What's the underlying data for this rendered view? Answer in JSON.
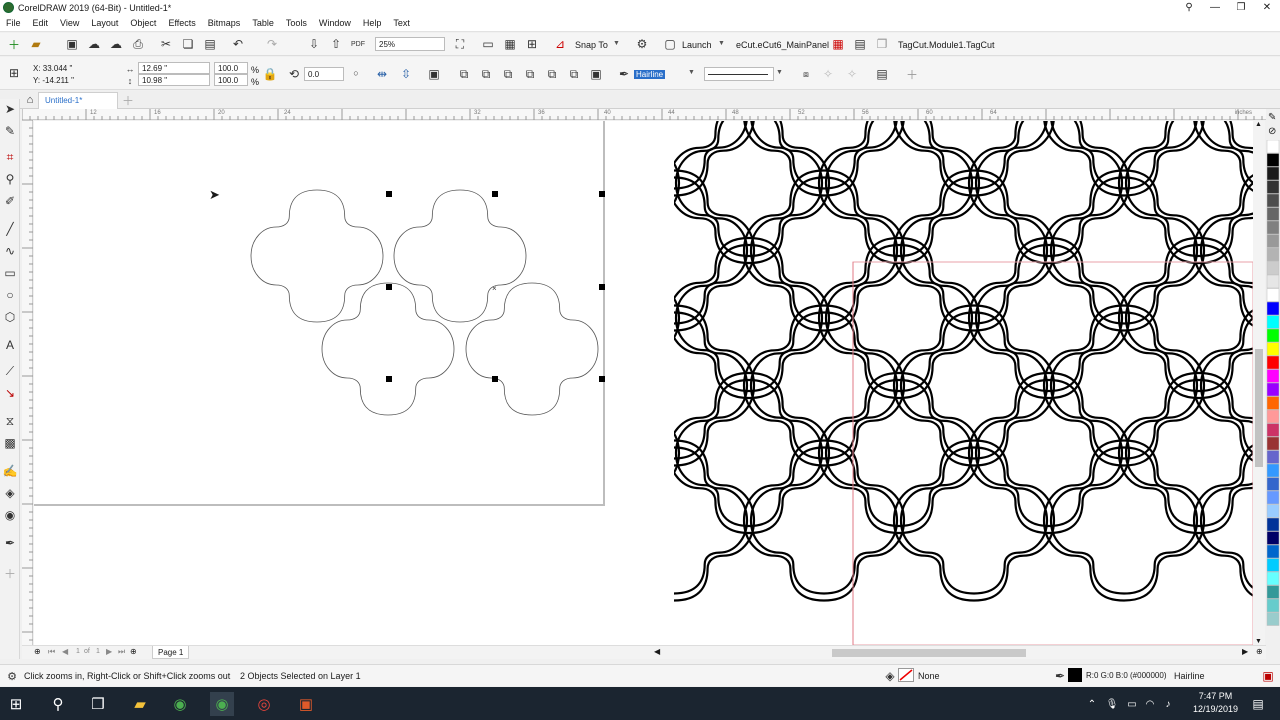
{
  "app": {
    "title": "CorelDRAW 2019 (64-Bit) - Untitled-1*"
  },
  "menu": [
    "File",
    "Edit",
    "View",
    "Layout",
    "Object",
    "Effects",
    "Bitmaps",
    "Table",
    "Tools",
    "Window",
    "Help",
    "Text"
  ],
  "toolbar1": {
    "zoom_value": "25%",
    "snap_label": "Snap To",
    "launch_label": "Launch",
    "macro_label": "eCut.eCut6_MainPanel",
    "tagcut_label": "TagCut.Module1.TagCut"
  },
  "toolbar2": {
    "x": "X: 33.044 \"",
    "y": "Y: -14.211 \"",
    "w": "12.69 \"",
    "h": "10.98 \"",
    "scale_w": "100.0",
    "scale_h": "100.0",
    "pct": "%",
    "rotation": "0.0",
    "outline": "Hairline"
  },
  "ruler": {
    "h_ticks": [
      "12",
      "16",
      "20",
      "24",
      "32",
      "36",
      "40",
      "44",
      "48",
      "52",
      "56",
      "60",
      "64"
    ],
    "unit": "inches"
  },
  "tabs": {
    "document": "Untitled-1*"
  },
  "navigation": {
    "page_of": "1",
    "of_label": "of",
    "page_total": "1",
    "page_tab": "Page 1"
  },
  "status": {
    "hint": "Click zooms in, Right-Click or Shift+Click zooms out",
    "selection": "2 Objects Selected on Layer 1",
    "fill": "None",
    "outline_color": "R:0 G:0 B:0 (#000000)",
    "outline_width": "Hairline"
  },
  "taskbar": {
    "time": "7:47 PM",
    "date": "12/19/2019"
  },
  "palette_colors": [
    "#ffffff",
    "#000000",
    "#1a1a1a",
    "#333333",
    "#4d4d4d",
    "#666666",
    "#808080",
    "#999999",
    "#b3b3b3",
    "#cccccc",
    "#e6e6e6",
    "#ffffff",
    "#0000ff",
    "#00ffff",
    "#00ff00",
    "#ffff00",
    "#ff0000",
    "#ff00ff",
    "#9900ff",
    "#ff6600",
    "#ff9999",
    "#cc3366",
    "#993333",
    "#6666cc",
    "#3399ff",
    "#3366cc",
    "#6699ff",
    "#99ccff",
    "#003399",
    "#000066",
    "#0066cc",
    "#00ccff",
    "#66ffff",
    "#339999",
    "#66cccc",
    "#99cccc"
  ]
}
